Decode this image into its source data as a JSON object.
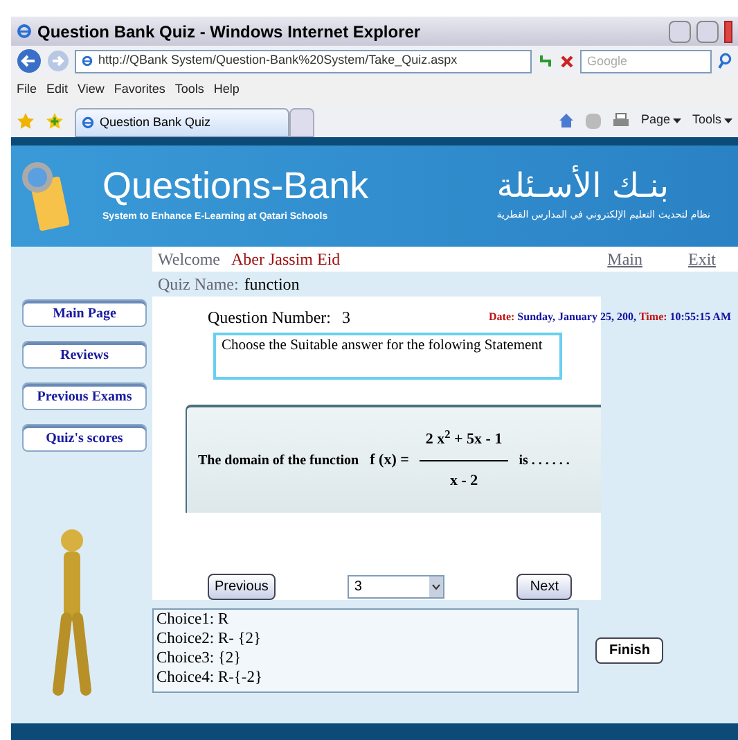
{
  "window": {
    "title": "Question Bank Quiz - Windows Internet Explorer"
  },
  "address_bar": {
    "url": "http://QBank System/Question-Bank%20System/Take_Quiz.aspx"
  },
  "search": {
    "placeholder": "Google"
  },
  "menu": [
    "File",
    "Edit",
    "View",
    "Favorites",
    "Tools",
    "Help"
  ],
  "tabs": [
    {
      "label": "Question Bank Quiz",
      "selected": true
    }
  ],
  "command_bar": [
    "Page",
    "Tools"
  ],
  "banner": {
    "title": "Questions-Bank",
    "subtitle": "System to Enhance E-Learning at Qatari Schools",
    "arabic_title": "بنـك الأسـئلة",
    "arabic_subtitle": "نظام لتحديث التعليم الإلكتروني في المدارس القطرية"
  },
  "welcome": {
    "label": "Welcome",
    "user": "Aber Jassim Eid",
    "links": [
      "Main",
      "Exit"
    ]
  },
  "quiz": {
    "label": "Quiz Name:",
    "name": "function"
  },
  "sidebar": {
    "items": [
      "Main Page",
      "Reviews",
      "Previous Exams",
      "Quiz's scores"
    ]
  },
  "question_number": {
    "label": "Question Number:",
    "value": "3"
  },
  "datetime": [
    {
      "kind": "label",
      "text": "Date:"
    },
    {
      "kind": "value",
      "text": "Sunday, January 25, 200,"
    },
    {
      "kind": "label",
      "text": "Time:"
    },
    {
      "kind": "value",
      "text": "10:55:15 AM"
    }
  ],
  "instruction": "Choose the Suitable answer for the folowing Statement",
  "statement": {
    "lead": "The domain of the function",
    "lhs": "f (x) =",
    "numerator": "2 x$^{2}$ + 5x - 1",
    "denominator": "x - 2",
    "tail": "is . . . . . ."
  },
  "navigation": {
    "previous": "Previous",
    "question_select": "3",
    "next": "Next"
  },
  "choices": [
    "Choice1: R",
    "Choice2: R- {2}",
    "Choice3: {2}",
    "Choice4: R-{-2}"
  ],
  "finish": "Finish"
}
